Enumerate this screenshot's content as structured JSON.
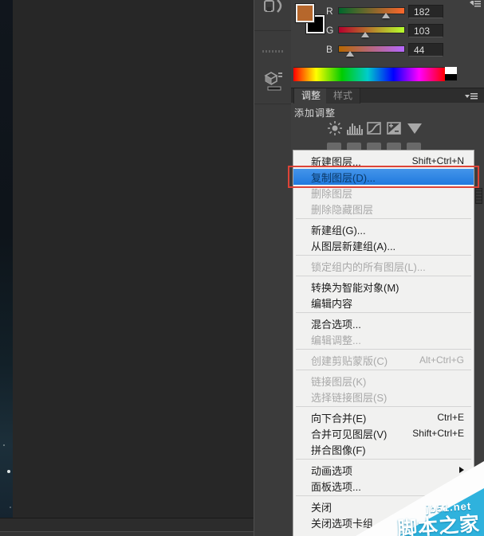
{
  "color_panel": {
    "foreground_color": "#B6672C",
    "background_color": "#000000",
    "channels": [
      {
        "label": "R",
        "value": "182",
        "pos": 0.715,
        "grad_left": "#00672C",
        "grad_right": "#FF672C"
      },
      {
        "label": "G",
        "value": "103",
        "pos": 0.404,
        "grad_left": "#B6002C",
        "grad_right": "#B6FF2C"
      },
      {
        "label": "B",
        "value": "44",
        "pos": 0.173,
        "grad_left": "#B66700",
        "grad_right": "#B667FF"
      }
    ]
  },
  "adjustments": {
    "tabs": [
      {
        "label": "调整",
        "active": true,
        "name": "tab-adjustments"
      },
      {
        "label": "样式",
        "active": false,
        "name": "tab-styles"
      }
    ],
    "section_label": "添加调整",
    "icons": [
      "brightness-contrast-icon",
      "levels-icon",
      "curves-icon",
      "exposure-icon",
      "vibrance-icon"
    ]
  },
  "context_menu": {
    "items": [
      {
        "name": "new-layer",
        "label": "新建图层...",
        "shortcut": "Shift+Ctrl+N"
      },
      {
        "name": "duplicate-layer",
        "label": "复制图层(D)...",
        "highlighted": true
      },
      {
        "name": "delete-layer",
        "label": "删除图层",
        "disabled": true
      },
      {
        "name": "delete-hidden-layers",
        "label": "删除隐藏图层",
        "disabled": true
      },
      {
        "sep": true
      },
      {
        "name": "new-group",
        "label": "新建组(G)..."
      },
      {
        "name": "new-group-from-layers",
        "label": "从图层新建组(A)..."
      },
      {
        "sep": true
      },
      {
        "name": "lock-all-layers-in-group",
        "label": "锁定组内的所有图层(L)...",
        "disabled": true
      },
      {
        "sep": true
      },
      {
        "name": "convert-to-smart-object",
        "label": "转换为智能对象(M)"
      },
      {
        "name": "edit-contents",
        "label": "编辑内容"
      },
      {
        "sep": true
      },
      {
        "name": "blending-options",
        "label": "混合选项..."
      },
      {
        "name": "edit-adjustment",
        "label": "编辑调整...",
        "disabled": true
      },
      {
        "sep": true
      },
      {
        "name": "create-clipping-mask",
        "label": "创建剪贴蒙版(C)",
        "shortcut": "Alt+Ctrl+G",
        "disabled": true
      },
      {
        "sep": true
      },
      {
        "name": "link-layers",
        "label": "链接图层(K)",
        "disabled": true
      },
      {
        "name": "select-linked-layers",
        "label": "选择链接图层(S)",
        "disabled": true
      },
      {
        "sep": true
      },
      {
        "name": "merge-down",
        "label": "向下合并(E)",
        "shortcut": "Ctrl+E"
      },
      {
        "name": "merge-visible",
        "label": "合并可见图层(V)",
        "shortcut": "Shift+Ctrl+E"
      },
      {
        "name": "flatten-image",
        "label": "拼合图像(F)"
      },
      {
        "sep": true
      },
      {
        "name": "animation-options",
        "label": "动画选项",
        "submenu": true
      },
      {
        "name": "panel-options",
        "label": "面板选项..."
      },
      {
        "sep": true
      },
      {
        "name": "close",
        "label": "关闭"
      },
      {
        "name": "close-tab-group",
        "label": "关闭选项卡组"
      }
    ]
  },
  "watermark": {
    "site": "jb51.net",
    "name": "脚本之家",
    "color": "#2FB2DD"
  }
}
